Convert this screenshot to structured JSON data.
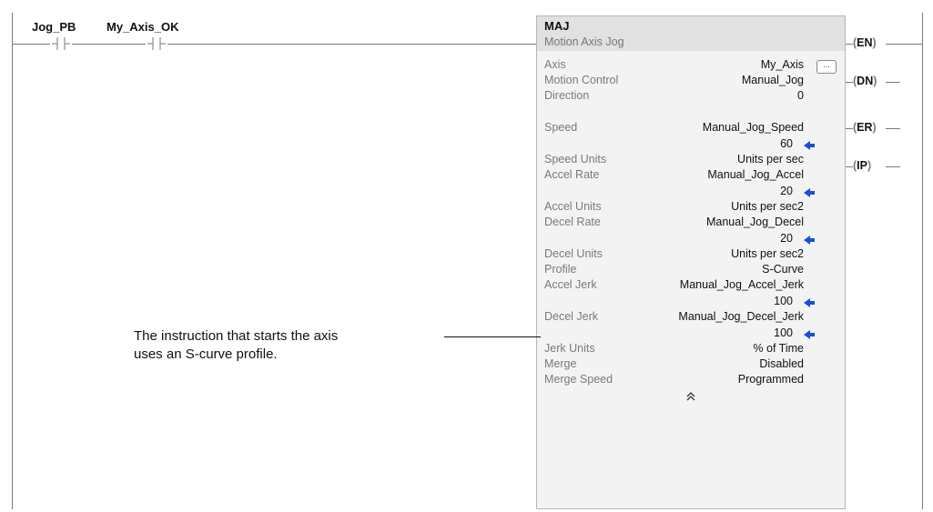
{
  "contacts": [
    {
      "tag": "Jog_PB"
    },
    {
      "tag": "My_Axis_OK"
    }
  ],
  "block": {
    "name": "MAJ",
    "description": "Motion Axis Jog",
    "rows": [
      {
        "label": "Axis",
        "value": "My_Axis"
      },
      {
        "label": "Motion Control",
        "value": "Manual_Jog"
      },
      {
        "label": "Direction",
        "value": "0"
      },
      {
        "label": "Speed",
        "value": "Manual_Jog_Speed"
      },
      {
        "label": "",
        "value": "60"
      },
      {
        "label": "Speed Units",
        "value": "Units per sec"
      },
      {
        "label": "Accel Rate",
        "value": "Manual_Jog_Accel"
      },
      {
        "label": "",
        "value": "20"
      },
      {
        "label": "Accel Units",
        "value": "Units per sec2"
      },
      {
        "label": "Decel Rate",
        "value": "Manual_Jog_Decel"
      },
      {
        "label": "",
        "value": "20"
      },
      {
        "label": "Decel Units",
        "value": "Units per sec2"
      },
      {
        "label": "Profile",
        "value": "S-Curve"
      },
      {
        "label": "Accel Jerk",
        "value": "Manual_Jog_Accel_Jerk"
      },
      {
        "label": "",
        "value": "100"
      },
      {
        "label": "Decel Jerk",
        "value": "Manual_Jog_Decel_Jerk"
      },
      {
        "label": "",
        "value": "100"
      },
      {
        "label": "Jerk Units",
        "value": "% of Time"
      },
      {
        "label": "Merge",
        "value": "Disabled"
      },
      {
        "label": "Merge Speed",
        "value": "Programmed"
      }
    ],
    "browse_button_label": "...",
    "collapse_icon": "double-chevron-up-icon"
  },
  "outputs": [
    {
      "label": "EN"
    },
    {
      "label": "DN"
    },
    {
      "label": "ER"
    },
    {
      "label": "IP"
    }
  ],
  "annotation": {
    "line1": "The instruction that starts the axis",
    "line2": "uses an S-curve profile."
  },
  "colors": {
    "arrow": "#1a4fd6",
    "rail": "#7a7a7a",
    "block_bg": "#f3f3f3"
  }
}
